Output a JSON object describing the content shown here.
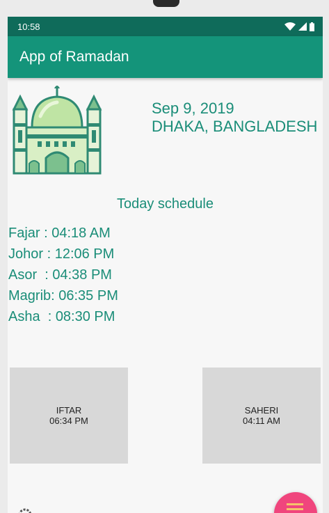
{
  "status_bar": {
    "time": "10:58"
  },
  "app_bar": {
    "title": "App of Ramadan"
  },
  "header": {
    "date": "Sep 9, 2019",
    "location": "DHAKA, BANGLADESH"
  },
  "schedule": {
    "title": "Today schedule",
    "prayers": [
      "Fajar : 04:18 AM",
      "Johor : 12:06 PM",
      "Asor  : 04:38 PM",
      "Magrib: 06:35 PM",
      "Asha  : 08:30 PM"
    ]
  },
  "cards": {
    "iftar": {
      "label": "IFTAR",
      "time": "06:34 PM"
    },
    "saheri": {
      "label": "SAHERI",
      "time": "04:11 AM"
    }
  },
  "colors": {
    "primary": "#14947a",
    "primary_dark": "#0f6b5a",
    "text_accent": "#1a8d78",
    "fab": "#f0457d"
  },
  "icons": [
    "wifi-icon",
    "signal-icon",
    "battery-icon",
    "mosque-icon",
    "settings-icon",
    "menu-icon"
  ]
}
